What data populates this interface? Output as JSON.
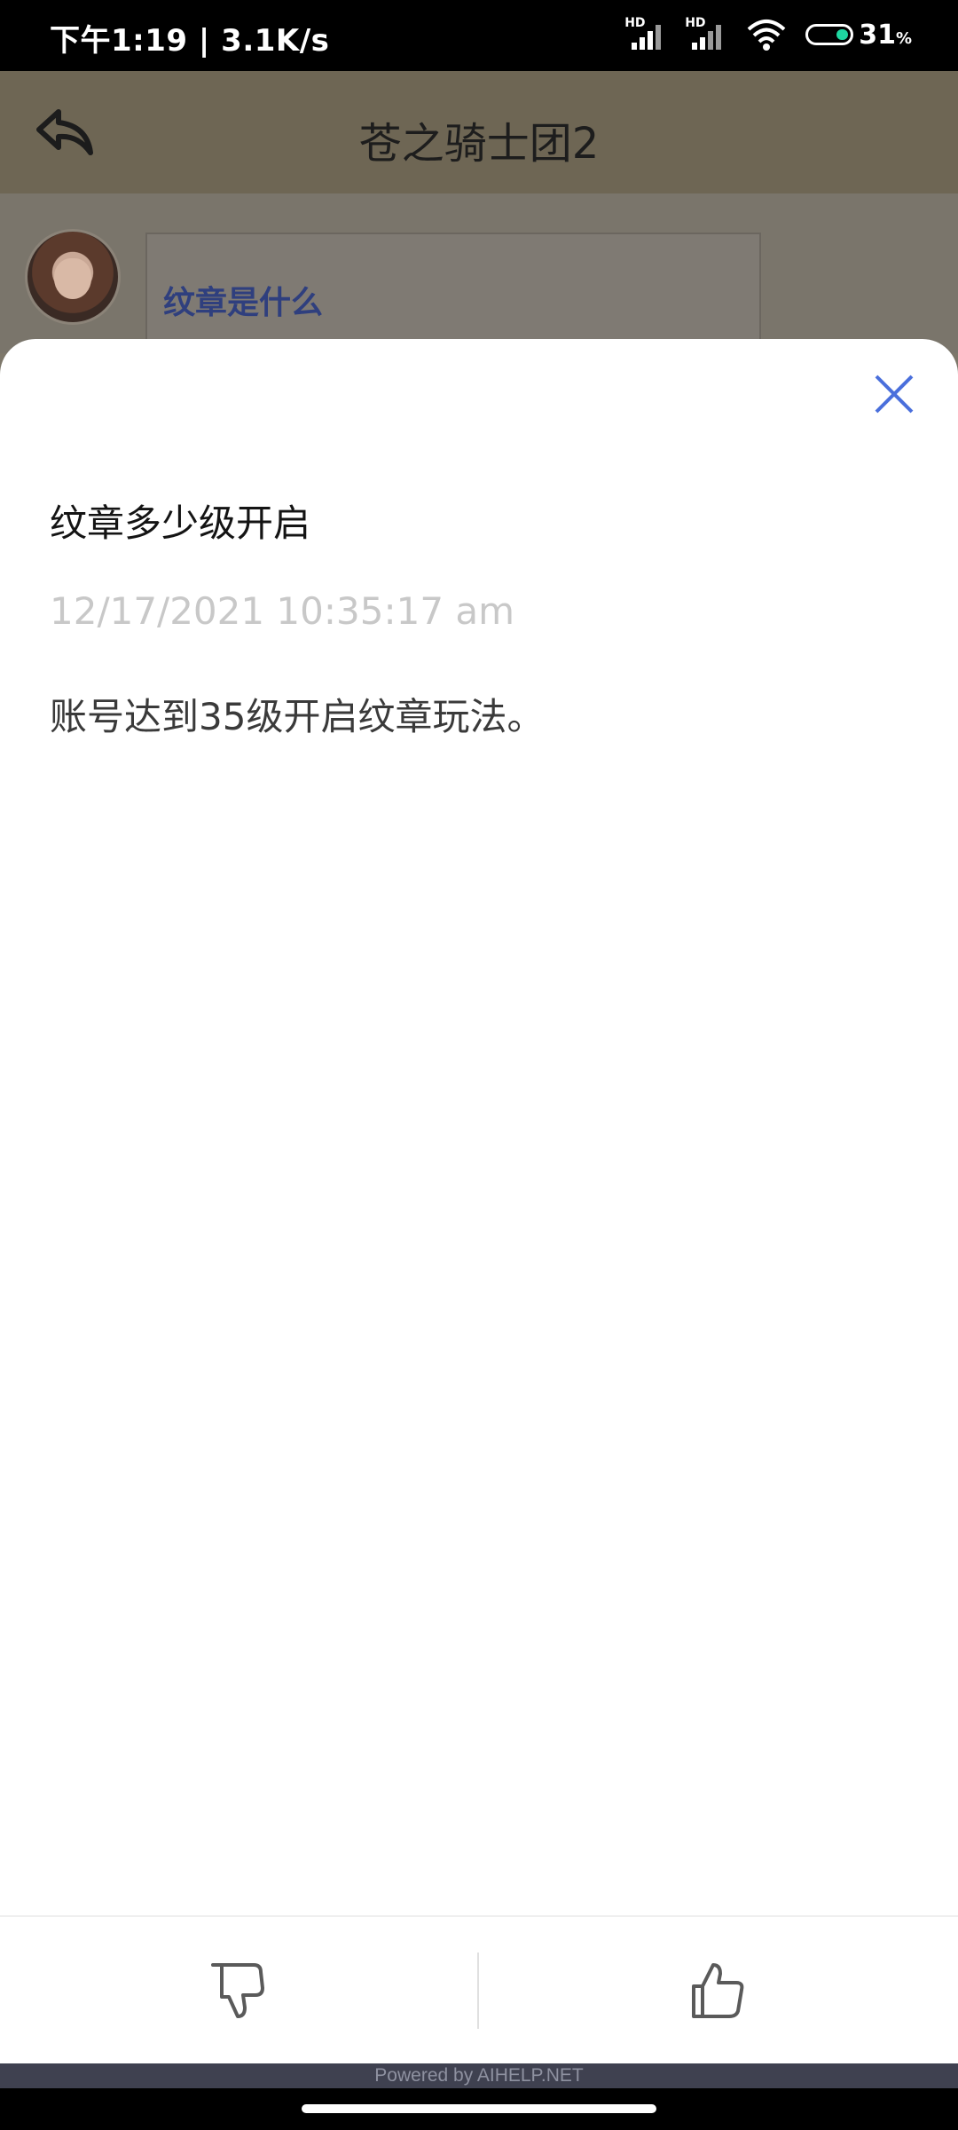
{
  "status_bar": {
    "time_speed": "下午1:19 | 3.1K/s",
    "sim1_label": "HD",
    "sim2_label": "HD",
    "battery_percent": "31",
    "battery_unit": "%",
    "battery_level": 0.31,
    "battery_color": "#1ed6a0"
  },
  "header": {
    "title": "苍之骑士团2",
    "back_icon": "reply-arrow-icon"
  },
  "chat_preview": {
    "message": "纹章是什么"
  },
  "faq_sheet": {
    "close_icon": "close-x-icon",
    "accent_color": "#4a6fdc",
    "title": "纹章多少级开启",
    "date": "12/17/2021 10:35:17 am",
    "answer": "账号达到35级开启纹章玩法。"
  },
  "feedback": {
    "dislike_icon": "thumbs-down-icon",
    "like_icon": "thumbs-up-icon"
  },
  "footer": {
    "powered_by": "Powered by AIHELP.NET"
  }
}
